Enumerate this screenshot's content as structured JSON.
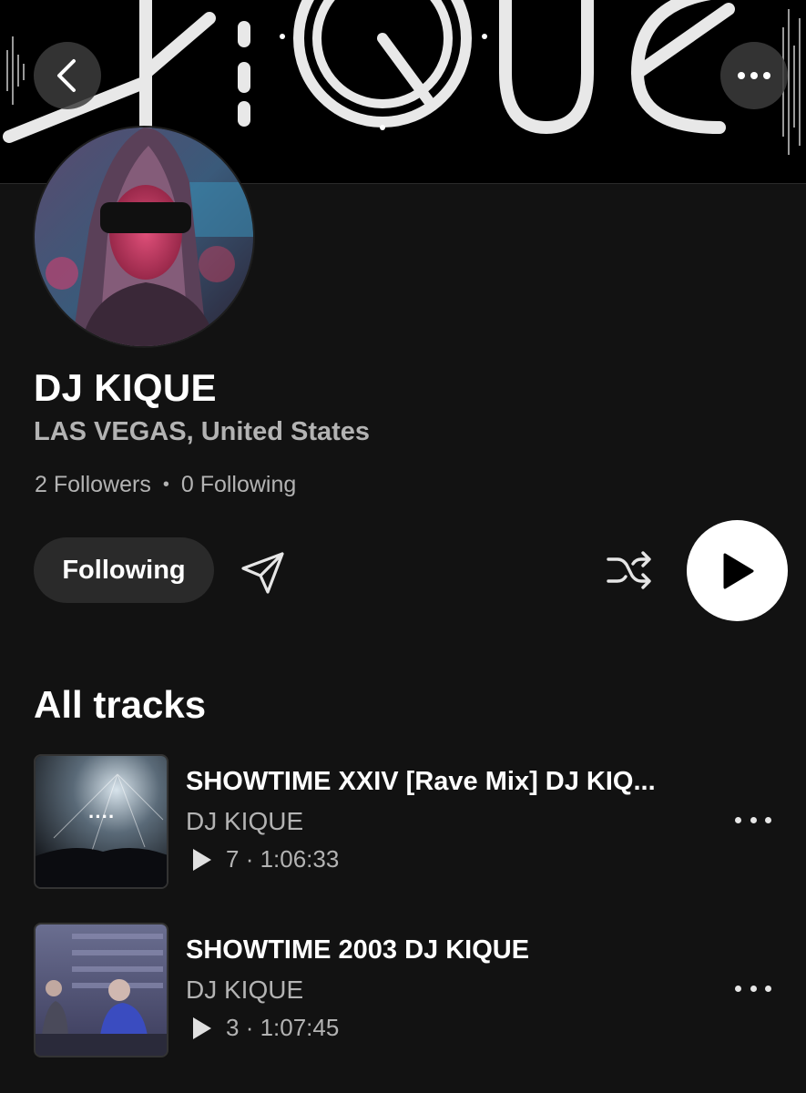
{
  "banner": {
    "logo_text": "KIQUE",
    "icon": "kique-logo-banner"
  },
  "header": {
    "back_icon": "chevron-left-icon",
    "more_icon": "more-horizontal-icon"
  },
  "profile": {
    "name": "DJ KIQUE",
    "location": "LAS VEGAS, United States",
    "followers": "2 Followers",
    "separator": "•",
    "following": "0 Following"
  },
  "actions": {
    "following_label": "Following",
    "share_icon": "send-icon",
    "shuffle_icon": "shuffle-icon",
    "play_icon": "play-icon"
  },
  "section": {
    "title": "All tracks"
  },
  "tracks": [
    {
      "title": "SHOWTIME XXIV [Rave Mix] DJ KIQ...",
      "artist": "DJ KIQUE",
      "plays": "7",
      "duration": "1:06:33",
      "thumb_overlay": "····"
    },
    {
      "title": "SHOWTIME 2003 DJ KIQUE",
      "artist": "DJ KIQUE",
      "plays": "3",
      "duration": "1:07:45"
    }
  ],
  "colors": {
    "background": "#121212",
    "secondary_text": "#b3b3b3",
    "pill": "#2a2a2a",
    "accent": "#ffffff"
  }
}
